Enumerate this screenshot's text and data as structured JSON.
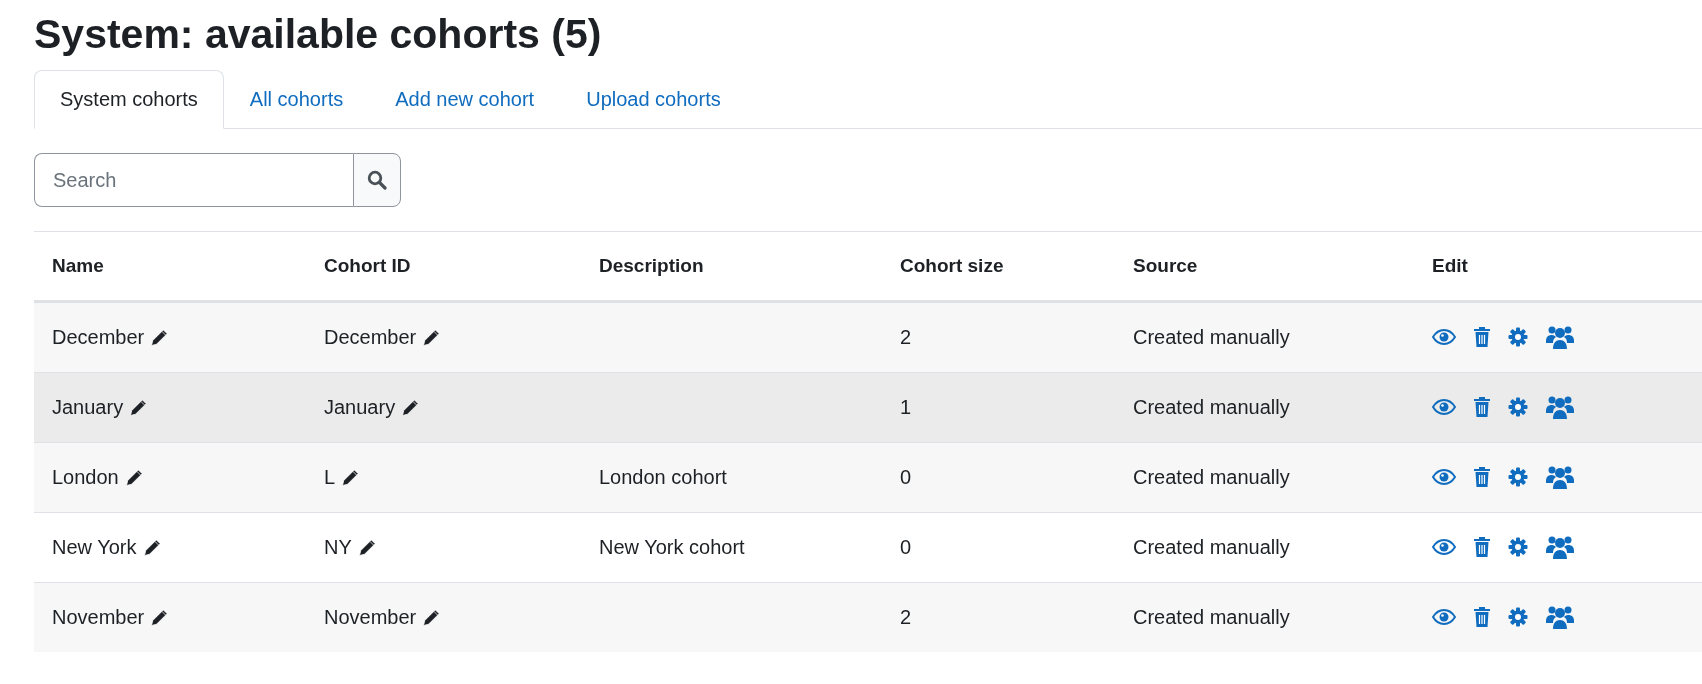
{
  "title": "System: available cohorts (5)",
  "tabs": [
    {
      "label": "System cohorts",
      "selected": true
    },
    {
      "label": "All cohorts",
      "selected": false
    },
    {
      "label": "Add new cohort",
      "selected": false
    },
    {
      "label": "Upload cohorts",
      "selected": false
    }
  ],
  "search": {
    "placeholder": "Search"
  },
  "table": {
    "columns": [
      "Name",
      "Cohort ID",
      "Description",
      "Cohort size",
      "Source",
      "Edit"
    ],
    "rows": [
      {
        "name": "December",
        "cohort_id": "December",
        "description": "",
        "size": "2",
        "source": "Created manually",
        "highlighted": false
      },
      {
        "name": "January",
        "cohort_id": "January",
        "description": "",
        "size": "1",
        "source": "Created manually",
        "highlighted": true
      },
      {
        "name": "London",
        "cohort_id": "L",
        "description": "London cohort",
        "size": "0",
        "source": "Created manually",
        "highlighted": false
      },
      {
        "name": "New York",
        "cohort_id": "NY",
        "description": "New York cohort",
        "size": "0",
        "source": "Created manually",
        "highlighted": false
      },
      {
        "name": "November",
        "cohort_id": "November",
        "description": "",
        "size": "2",
        "source": "Created manually",
        "highlighted": false
      }
    ]
  }
}
